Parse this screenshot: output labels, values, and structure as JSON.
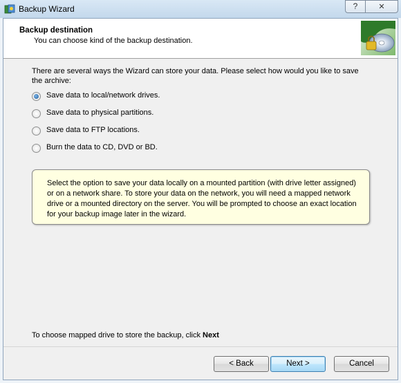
{
  "window": {
    "title": "Backup Wizard",
    "help_glyph": "?",
    "close_glyph": "✕"
  },
  "header": {
    "title": "Backup destination",
    "subtitle": "You can choose kind of the backup destination.",
    "icon": "disc-backup-icon"
  },
  "main": {
    "intro": "There are several ways the Wizard can store your data. Please select how would you like to save the archive:",
    "options": [
      {
        "label": "Save data to local/network drives.",
        "selected": true
      },
      {
        "label": "Save data to physical partitions.",
        "selected": false
      },
      {
        "label": "Save data to FTP locations.",
        "selected": false
      },
      {
        "label": "Burn the data to CD, DVD or BD.",
        "selected": false
      }
    ],
    "info": "Select the option to save your data locally on a mounted partition (with drive letter assigned) or on a network share. To store your data on the network, you will need a mapped network drive or a mounted directory on the server. You will be prompted to choose an exact location for your backup image later in the wizard.",
    "bottom_note_prefix": "To choose mapped drive to store the backup, click ",
    "bottom_note_bold": "Next"
  },
  "buttons": {
    "back": "< Back",
    "next": "Next >",
    "cancel": "Cancel"
  }
}
